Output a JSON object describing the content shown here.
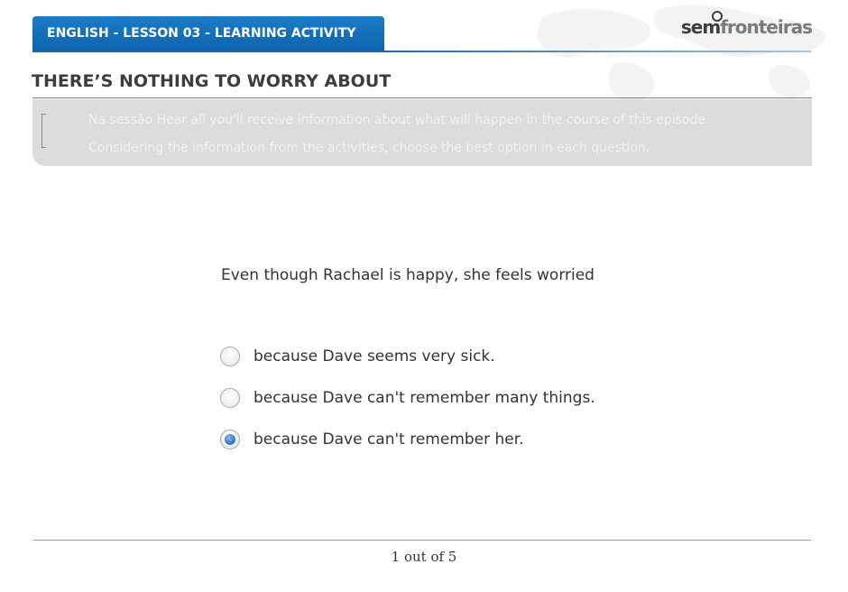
{
  "header": {
    "lesson_label": "ENGLISH - LESSON 03 - LEARNING ACTIVITY",
    "brand": {
      "part1": "sem",
      "part2": "fronteiras"
    },
    "accent_color": "#1472bd"
  },
  "page": {
    "title": "THERE’S NOTHING TO WORRY ABOUT",
    "instructions": "Na sessão Hear all you'll receive information about what will happen in the course of this episode. Considering the information from the activities, choose the best option in each question."
  },
  "question": {
    "prompt": "Even though Rachael is happy, she feels worried",
    "options": [
      {
        "label": "because Dave seems very sick.",
        "selected": false
      },
      {
        "label": "because Dave can't remember many things.",
        "selected": false
      },
      {
        "label": "because Dave can't remember her.",
        "selected": true
      }
    ]
  },
  "footer": {
    "pagination": "1 out of 5"
  },
  "icons": {
    "logo_pin": "location-pin-icon",
    "instructions": "bracket-icon"
  }
}
